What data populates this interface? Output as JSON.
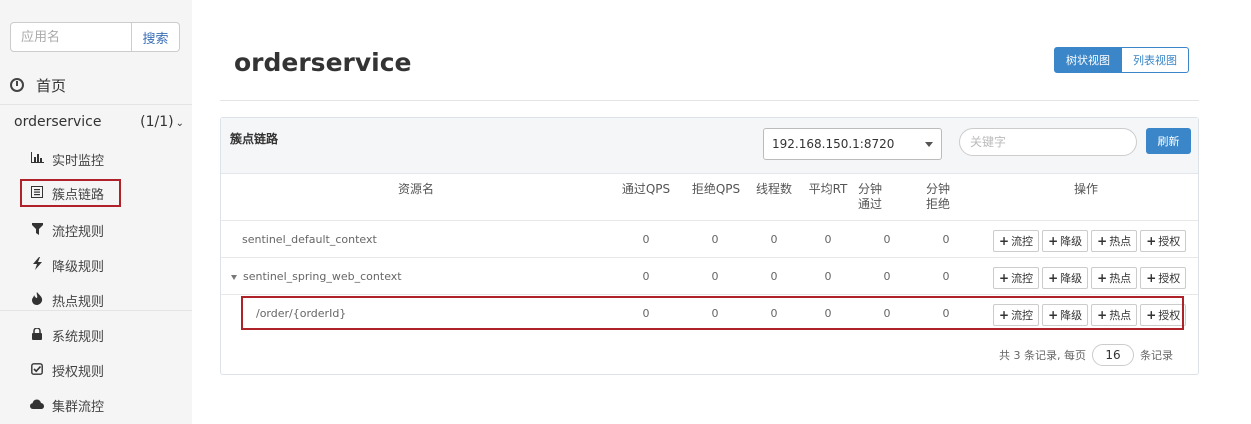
{
  "sidebar": {
    "search": {
      "placeholder": "应用名",
      "button_label": "搜索"
    },
    "home_label": "首页",
    "app": {
      "name": "orderservice",
      "count": "(1/1)",
      "toggle": "chevron-down"
    },
    "menu": [
      {
        "label": "实时监控",
        "icon": "bar-chart-icon"
      },
      {
        "label": "簇点链路",
        "icon": "list-icon",
        "active": true
      },
      {
        "label": "流控规则",
        "icon": "filter-icon"
      },
      {
        "label": "降级规则",
        "icon": "flash-icon"
      },
      {
        "label": "热点规则",
        "icon": "fire-icon"
      },
      {
        "label": "系统规则",
        "icon": "lock-icon"
      },
      {
        "label": "授权规则",
        "icon": "check-icon"
      },
      {
        "label": "集群流控",
        "icon": "cloud-icon"
      }
    ]
  },
  "header": {
    "title": "orderservice",
    "views": {
      "tree": "树状视图",
      "list": "列表视图"
    }
  },
  "panel": {
    "title": "簇点链路",
    "machine": "192.168.150.1:8720",
    "keyword_placeholder": "关键字",
    "refresh_label": "刷新",
    "columns": {
      "resource": "资源名",
      "pass_qps": "通过QPS",
      "block_qps": "拒绝QPS",
      "threads": "线程数",
      "avg_rt": "平均RT",
      "minute_pass": "分钟通过",
      "minute_block": "分钟拒绝",
      "ops": "操作"
    },
    "ops_labels": {
      "flow": "流控",
      "degrade": "降级",
      "hot": "热点",
      "auth": "授权"
    },
    "rows": [
      {
        "name": "sentinel_default_context",
        "pass_qps": "0",
        "block_qps": "0",
        "threads": "0",
        "avg_rt": "0",
        "minute_pass": "0",
        "minute_block": "0"
      },
      {
        "name": "sentinel_spring_web_context",
        "pass_qps": "0",
        "block_qps": "0",
        "threads": "0",
        "avg_rt": "0",
        "minute_pass": "0",
        "minute_block": "0"
      },
      {
        "name": "/order/{orderId}",
        "pass_qps": "0",
        "block_qps": "0",
        "threads": "0",
        "avg_rt": "0",
        "minute_pass": "0",
        "minute_block": "0"
      }
    ],
    "pager": {
      "total_text": "共 3 条记录, 每页",
      "page_size": "16",
      "suffix": "条记录"
    }
  },
  "colors": {
    "primary": "#3a86c8",
    "highlight_border": "#b0222a",
    "sidebar_bg": "#f5f5f5"
  }
}
